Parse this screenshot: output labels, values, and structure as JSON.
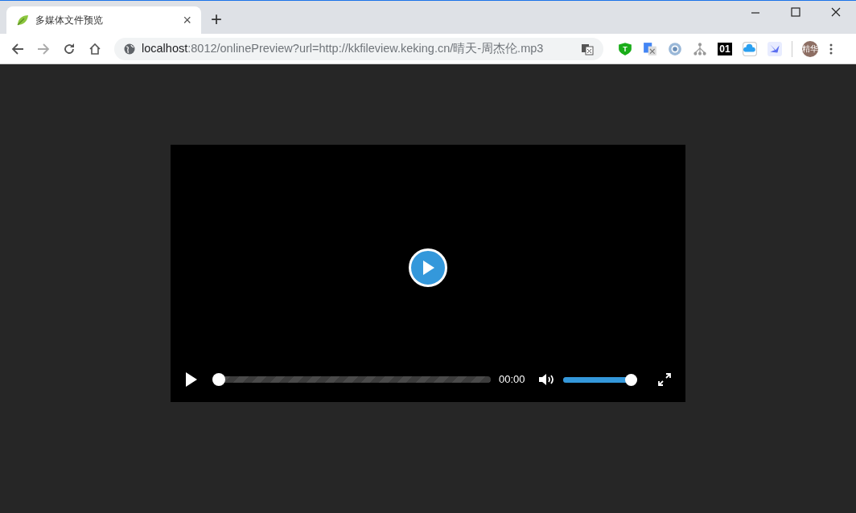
{
  "tab": {
    "title": "多媒体文件预览",
    "close": "×",
    "new_tab": "+"
  },
  "address_bar": {
    "host": "localhost",
    "rest": ":8012/onlinePreview?url=http://kkfileview.keking.cn/晴天-周杰伦.mp3"
  },
  "extensions": [
    {
      "kind": "shield",
      "text": "T"
    },
    {
      "kind": "translate"
    },
    {
      "kind": "ring"
    },
    {
      "kind": "tree"
    },
    {
      "kind": "badge",
      "text": "01"
    },
    {
      "kind": "cloud"
    },
    {
      "kind": "bird"
    }
  ],
  "profile": {
    "text": "精华"
  },
  "player": {
    "progress": {
      "level": 0
    },
    "time": "00:00",
    "volume": {
      "level": 1
    }
  }
}
